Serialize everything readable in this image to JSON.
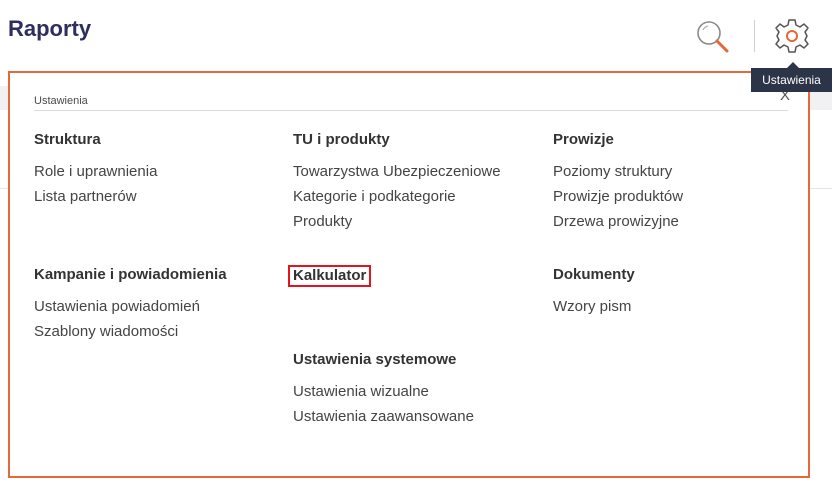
{
  "page": {
    "title": "Raporty",
    "tooltip": "Ustawienia"
  },
  "icons": {
    "search": "search-icon",
    "settings": "gear-icon"
  },
  "colors": {
    "accent": "#e6673a",
    "title": "#2f2f5f",
    "highlight": "#e3141e",
    "tooltip_bg": "#2c3448"
  },
  "panel": {
    "header": "Ustawienia",
    "close": "X",
    "sections": {
      "struktura": {
        "title": "Struktura",
        "items": [
          "Role i uprawnienia",
          "Lista partnerów"
        ]
      },
      "tu_produkty": {
        "title": "TU i produkty",
        "items": [
          "Towarzystwa Ubezpieczeniowe",
          "Kategorie i podkategorie",
          "Produkty"
        ]
      },
      "prowizje": {
        "title": "Prowizje",
        "items": [
          "Poziomy struktury",
          "Prowizje produktów",
          "Drzewa prowizyjne"
        ]
      },
      "kampanie": {
        "title": "Kampanie i powiadomienia",
        "items": [
          "Ustawienia powiadomień",
          "Szablony wiadomości"
        ]
      },
      "kalkulator": {
        "title": "Kalkulator"
      },
      "dokumenty": {
        "title": "Dokumenty",
        "items": [
          "Wzory pism"
        ]
      },
      "systemowe": {
        "title": "Ustawienia systemowe",
        "items": [
          "Ustawienia wizualne",
          "Ustawienia zaawansowane"
        ]
      }
    }
  }
}
